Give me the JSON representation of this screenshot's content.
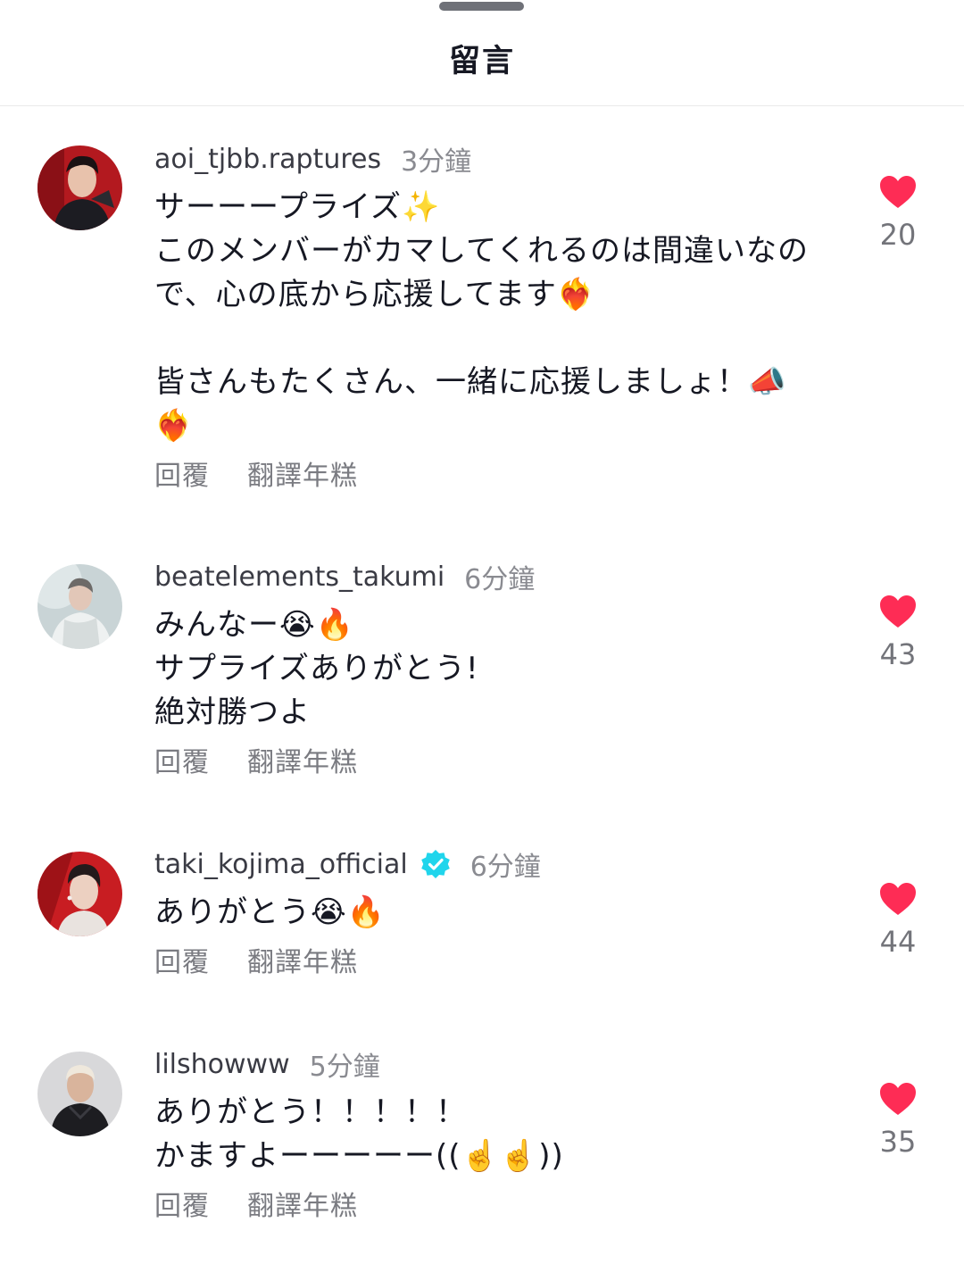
{
  "sheet": {
    "title": "留言"
  },
  "colors": {
    "heart": "#fe2c55",
    "verified": "#20d5ec"
  },
  "comments": [
    {
      "username": "aoi_tjbb.raptures",
      "time": "3分鐘",
      "verified": false,
      "text": "サーーープライズ✨\nこのメンバーがカマしてくれるのは間違いなので、心の底から応援してます❤️‍🔥\n\n皆さんもたくさん、一緒に応援しましょ！📣\n❤️‍🔥",
      "reply_label": "回覆",
      "translate_label": "翻譯年糕",
      "likes": "20"
    },
    {
      "username": "beatelements_takumi",
      "time": "6分鐘",
      "verified": false,
      "text": "みんなー😭🔥\nサプライズありがとう!\n絶対勝つよ",
      "reply_label": "回覆",
      "translate_label": "翻譯年糕",
      "likes": "43"
    },
    {
      "username": "taki_kojima_official",
      "time": "6分鐘",
      "verified": true,
      "text": "ありがとう😭🔥",
      "reply_label": "回覆",
      "translate_label": "翻譯年糕",
      "likes": "44"
    },
    {
      "username": "lilshowww",
      "time": "5分鐘",
      "verified": false,
      "text": "ありがとう！！！！！\nかますよーーーーー((☝️☝️))",
      "reply_label": "回覆",
      "translate_label": "翻譯年糕",
      "likes": "35"
    }
  ]
}
